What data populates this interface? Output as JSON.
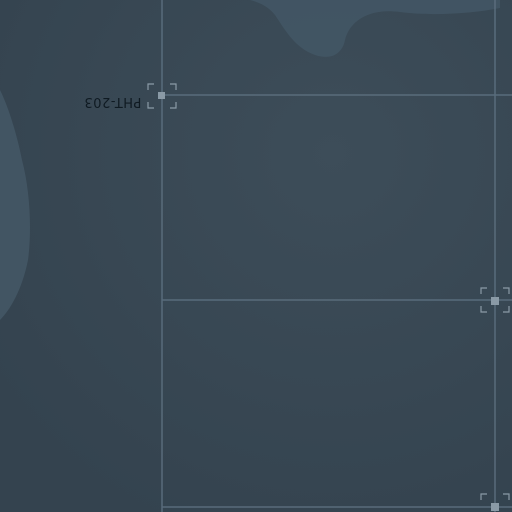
{
  "map": {
    "label": "PHT-203",
    "colors": {
      "water": "#3a4955",
      "land": "#445866",
      "grid": "#5d7080",
      "marker": "#8a9aa6"
    }
  }
}
